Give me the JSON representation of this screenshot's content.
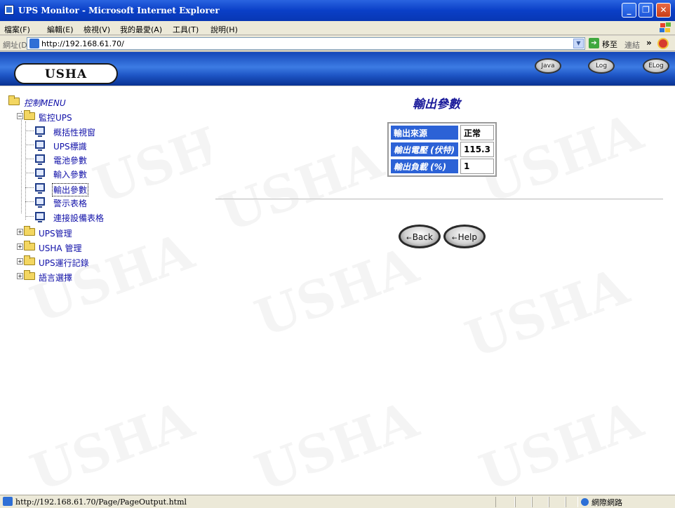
{
  "window": {
    "title": "UPS Monitor - Microsoft Internet Explorer",
    "buttons": [
      "_",
      "❐",
      "✕"
    ]
  },
  "menubar": {
    "items": [
      "檔案(F)",
      "編輯(E)",
      "檢視(V)",
      "我的最愛(A)",
      "工具(T)",
      "說明(H)"
    ]
  },
  "address": {
    "label": "網址(D)",
    "url": "http://192.168.61.70/",
    "go_label": "移至",
    "links_label": "連結",
    "links_chevron": "»"
  },
  "banner": {
    "logo_text": "USHA",
    "buttons": [
      "Java",
      "Log",
      "ELog"
    ]
  },
  "tree": {
    "root": "控制MENU",
    "monitor_group": "監控UPS",
    "monitor_items": [
      "概括性視窗",
      "UPS標識",
      "電池參數",
      "輸入參數",
      "輸出參數",
      "警示表格",
      "連接設備表格"
    ],
    "other_groups": [
      "UPS管理",
      "USHA 管理",
      "UPS運行記錄",
      "語言選擇"
    ]
  },
  "content": {
    "heading": "輸出參數",
    "rows": [
      {
        "key": "輸出來源",
        "value": "正常"
      },
      {
        "key": "輸出電壓 (伏特)",
        "value": "115.3"
      },
      {
        "key": "輸出負載 (%)",
        "value": "1"
      }
    ],
    "buttons": [
      "Back",
      "Help"
    ]
  },
  "watermark": "USHA",
  "status": {
    "url": "http://192.168.61.70/Page/PageOutput.html",
    "zone": "網際網路"
  }
}
